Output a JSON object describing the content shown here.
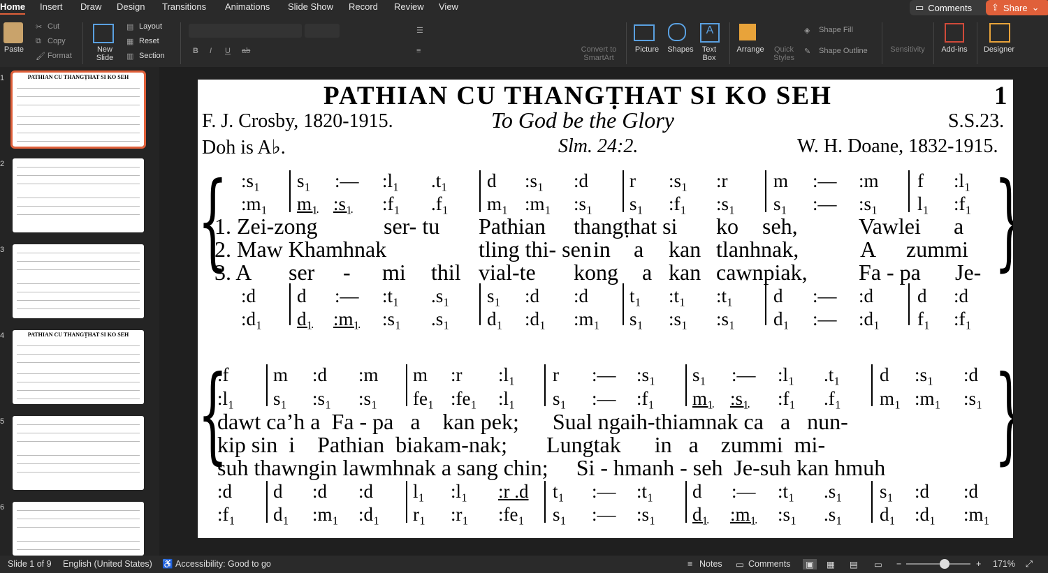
{
  "tabs": [
    "Home",
    "Insert",
    "Draw",
    "Design",
    "Transitions",
    "Animations",
    "Slide Show",
    "Record",
    "Review",
    "View"
  ],
  "top_buttons": {
    "comments": "Comments",
    "share": "Share"
  },
  "ribbon": {
    "paste": "Paste",
    "cut": "Cut",
    "copy": "Copy",
    "format": "Format",
    "new_slide": "New\nSlide",
    "layout": "Layout",
    "reset": "Reset",
    "section": "Section",
    "convert": "Convert to\nSmartArt",
    "picture": "Picture",
    "shapes": "Shapes",
    "text_box": "Text\nBox",
    "arrange": "Arrange",
    "quick_styles": "Quick\nStyles",
    "shape_fill": "Shape Fill",
    "shape_outline": "Shape Outline",
    "sensitivity": "Sensitivity",
    "addins": "Add-ins",
    "designer": "Designer"
  },
  "thumbnails": [
    {
      "num": "1",
      "title": "PATHIAN CU THANGṬHAT SI KO SEH"
    },
    {
      "num": "2",
      "title": ""
    },
    {
      "num": "3",
      "title": ""
    },
    {
      "num": "4",
      "title": "PATHIAN CU THANGṬHAT SI KO SEH"
    },
    {
      "num": "5",
      "title": ""
    },
    {
      "num": "6",
      "title": ""
    }
  ],
  "slide": {
    "title": "PATHIAN CU THANGṬHAT SI KO SEH",
    "number": "1",
    "author": "F. J. Crosby, 1820-1915.",
    "english_title": "To God be the Glory",
    "ref": "S.S.23.",
    "key": "Doh is A♭.",
    "scripture": "Slm. 24:2.",
    "composer": "W. H. Doane, 1832-1915.",
    "system1": {
      "soprano": [
        ":s₁",
        "s₁",
        ":—",
        ":l₁",
        ".t₁",
        "d",
        ":s₁",
        ":d",
        "r",
        ":s₁",
        ":r",
        "m",
        ":—",
        ":m",
        "f",
        ":l₁"
      ],
      "alto": [
        ":m₁",
        "m₁",
        ":s₁",
        ":f₁",
        ".f₁",
        "m₁",
        ":m₁",
        ":s₁",
        "s₁",
        ":f₁",
        ":s₁",
        "s₁",
        ":—",
        ":s₁",
        "l₁",
        ":f₁"
      ],
      "verse1": [
        "1. Zei-zong",
        "ser- tu",
        "Pathian",
        "thangṭhat si",
        "ko",
        "seh,",
        "Vawlei",
        "a"
      ],
      "verse2": [
        "2. Maw Khamhnak",
        "tling thi- sen",
        "in",
        "a",
        "kan",
        "tlanhnak,",
        "A",
        "zummi"
      ],
      "verse3": [
        "3. A",
        "ser",
        "-",
        "mi",
        "thil",
        "vial-te",
        "kong",
        "a",
        "kan",
        "cawnpiak,",
        "Fa - pa",
        "Je-"
      ],
      "tenor": [
        ":d",
        "d",
        ":—",
        ":t₁",
        ".s₁",
        "s₁",
        ":d",
        ":d",
        "t₁",
        ":t₁",
        ":t₁",
        "d",
        ":—",
        ":d",
        "d",
        ":d"
      ],
      "bass": [
        ":d₁",
        "d₁",
        ":m₁",
        ":s₁",
        ".s₁",
        "d₁",
        ":d₁",
        ":m₁",
        "s₁",
        ":s₁",
        ":s₁",
        "d₁",
        ":—",
        ":d₁",
        "f₁",
        ":f₁"
      ]
    },
    "system2": {
      "soprano": [
        ":f",
        "m",
        ":d",
        ":m",
        "m",
        ":r",
        ":l₁",
        "r",
        ":—",
        ":s₁",
        "s₁",
        ":—",
        ":l₁",
        ".t₁",
        "d",
        ":s₁",
        ":d"
      ],
      "alto": [
        ":l₁",
        "s₁",
        ":s₁",
        ":s₁",
        "fe₁",
        ":fe₁",
        ":l₁",
        "s₁",
        ":—",
        ":f₁",
        "m₁",
        ":s₁",
        ":f₁",
        ".f₁",
        "m₁",
        ":m₁",
        ":s₁"
      ],
      "verse1": "dawt ca’h a  Fa - pa   a    kan pek;      Sual ngaih-thiamnak ca   a   nun-",
      "verse2": "kip sin  i    Pathian  biakam-nak;       Lungtak      in   a    zummi  mi-",
      "verse3": "suh thawngin lawmhnak a sang chin;     Si - hmanh - seh  Je-suh kan hmuh",
      "tenor": [
        ":d",
        "d",
        ":d",
        ":d",
        "l₁",
        ":l₁",
        ":r .d",
        "t₁",
        ":—",
        ":t₁",
        "d",
        ":—",
        ":t₁",
        ".s₁",
        "s₁",
        ":d",
        ":d"
      ],
      "bass": [
        ":f₁",
        "d₁",
        ":m₁",
        ":d₁",
        "r₁",
        ":r₁",
        ":fe₁",
        "s₁",
        ":—",
        ":s₁",
        "d₁",
        ":m₁",
        ":s₁",
        ".s₁",
        "d₁",
        ":d₁",
        ":m₁"
      ]
    }
  },
  "status": {
    "slide": "Slide 1 of 9",
    "language": "English (United States)",
    "accessibility": "Accessibility: Good to go",
    "notes": "Notes",
    "comments": "Comments",
    "zoom": "171%"
  },
  "colors": {
    "accent": "#e0603a",
    "chrome": "#2a2a2a",
    "slide_bg": "#ffffff"
  }
}
